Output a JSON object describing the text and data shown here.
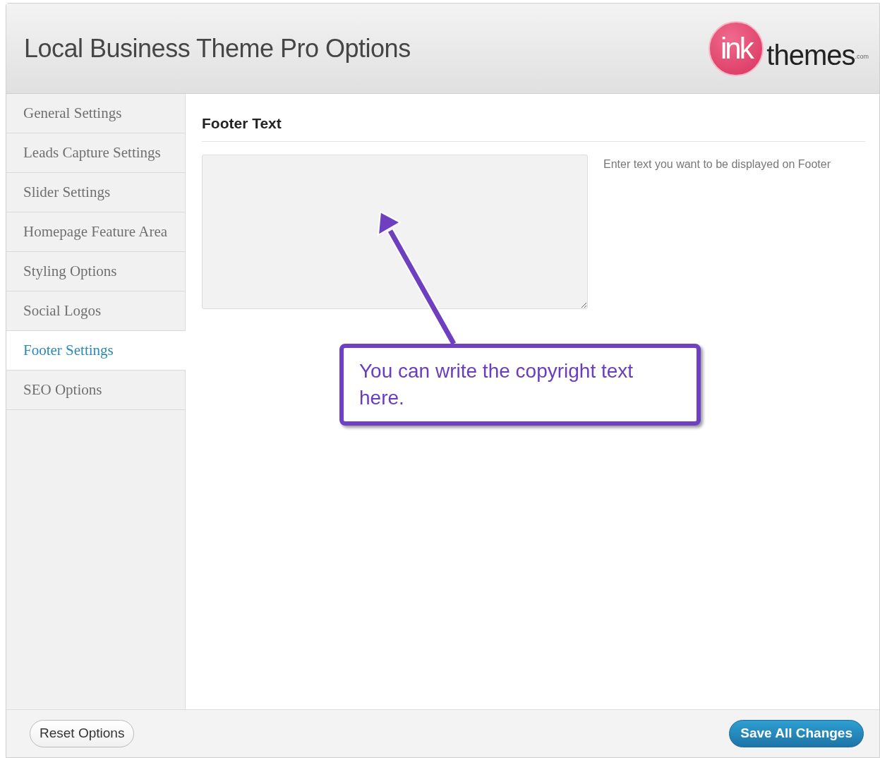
{
  "header": {
    "title": "Local Business Theme Pro Options",
    "logo": {
      "mark": "ink",
      "word": "themes",
      "suffix": ".com"
    }
  },
  "sidebar": {
    "items": [
      {
        "label": "General Settings",
        "selected": false
      },
      {
        "label": "Leads Capture Settings",
        "selected": false
      },
      {
        "label": "Slider Settings",
        "selected": false
      },
      {
        "label": "Homepage Feature Area",
        "selected": false
      },
      {
        "label": "Styling Options",
        "selected": false
      },
      {
        "label": "Social Logos",
        "selected": false
      },
      {
        "label": "Footer Settings",
        "selected": true
      },
      {
        "label": "SEO Options",
        "selected": false
      }
    ]
  },
  "section": {
    "heading": "Footer Text",
    "help": "Enter text you want to be displayed on Footer"
  },
  "callout": {
    "text": "You can write the copyright text here."
  },
  "footer": {
    "reset_button": "Reset Options",
    "save_button": "Save All Changes"
  }
}
